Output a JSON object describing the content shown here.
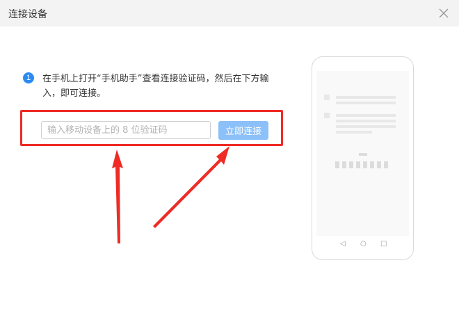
{
  "window": {
    "title": "连接设备",
    "close_icon": "close-icon"
  },
  "step": {
    "number": "1",
    "instruction": "在手机上打开“手机助手”查看连接验证码，然后在下方输入，即可连接。"
  },
  "form": {
    "code_input": {
      "placeholder": "输入移动设备上的 8 位验证码",
      "value": ""
    },
    "connect_label": "立即连接"
  },
  "phone_nav": {
    "back": "◁",
    "home": "○",
    "recent": "□"
  },
  "colors": {
    "accent": "#2b8bf2",
    "button_disabled": "#8cc0f8",
    "annotation_red": "#ee2b25",
    "titlebar_bg": "#f3f3f3"
  }
}
